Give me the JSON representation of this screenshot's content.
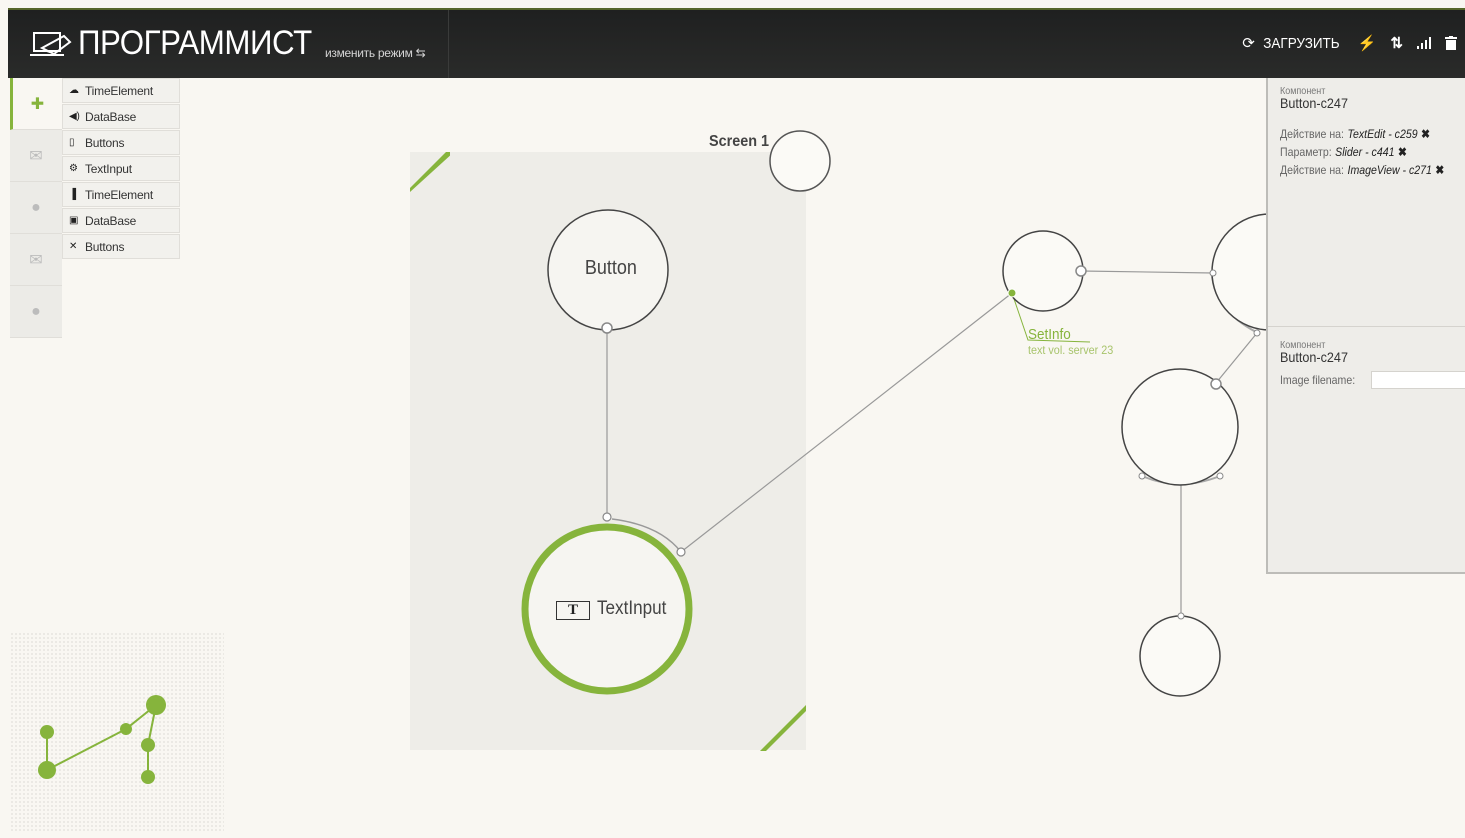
{
  "header": {
    "title": "ПРОГРАММИСТ",
    "mode_link": "изменить режим",
    "upload_label": "ЗАГРУЗИТЬ"
  },
  "sidebar": {
    "tabs": [
      {
        "icon": "puzzle-icon",
        "active": true
      },
      {
        "icon": "envelope-icon",
        "active": false
      },
      {
        "icon": "speech-bubble-icon",
        "active": false
      },
      {
        "icon": "envelope-icon",
        "active": false
      },
      {
        "icon": "speech-bubble-icon",
        "active": false
      }
    ],
    "components": [
      {
        "icon": "cloud-icon",
        "label": "TimeElement"
      },
      {
        "icon": "speaker-icon",
        "label": "DataBase"
      },
      {
        "icon": "phone-icon",
        "label": "Buttons"
      },
      {
        "icon": "gear-icon",
        "label": "TextInput"
      },
      {
        "icon": "chart-icon",
        "label": "TimeElement"
      },
      {
        "icon": "gamepad-icon",
        "label": "DataBase"
      },
      {
        "icon": "tools-icon",
        "label": "Buttons"
      }
    ]
  },
  "canvas": {
    "screen_label": "Screen 1",
    "nodes": {
      "button": "Button",
      "textinput": "TextInput",
      "textinput_icon": "T"
    },
    "connection": {
      "name": "SetInfo",
      "detail": "text vol. server 23"
    },
    "accent_color": "#86b43c"
  },
  "properties": {
    "top": {
      "caption": "Компонент",
      "component": "Button-c247",
      "rows": [
        {
          "label": "Действие на:",
          "value": "TextEdit - c259"
        },
        {
          "label": "Параметр:",
          "value": "Slider - c441"
        },
        {
          "label": "Действие на:",
          "value": "ImageView - c271"
        }
      ]
    },
    "bottom": {
      "caption": "Компонент",
      "component": "Button-c247",
      "field_label": "Image filename:",
      "field_value": ""
    }
  }
}
